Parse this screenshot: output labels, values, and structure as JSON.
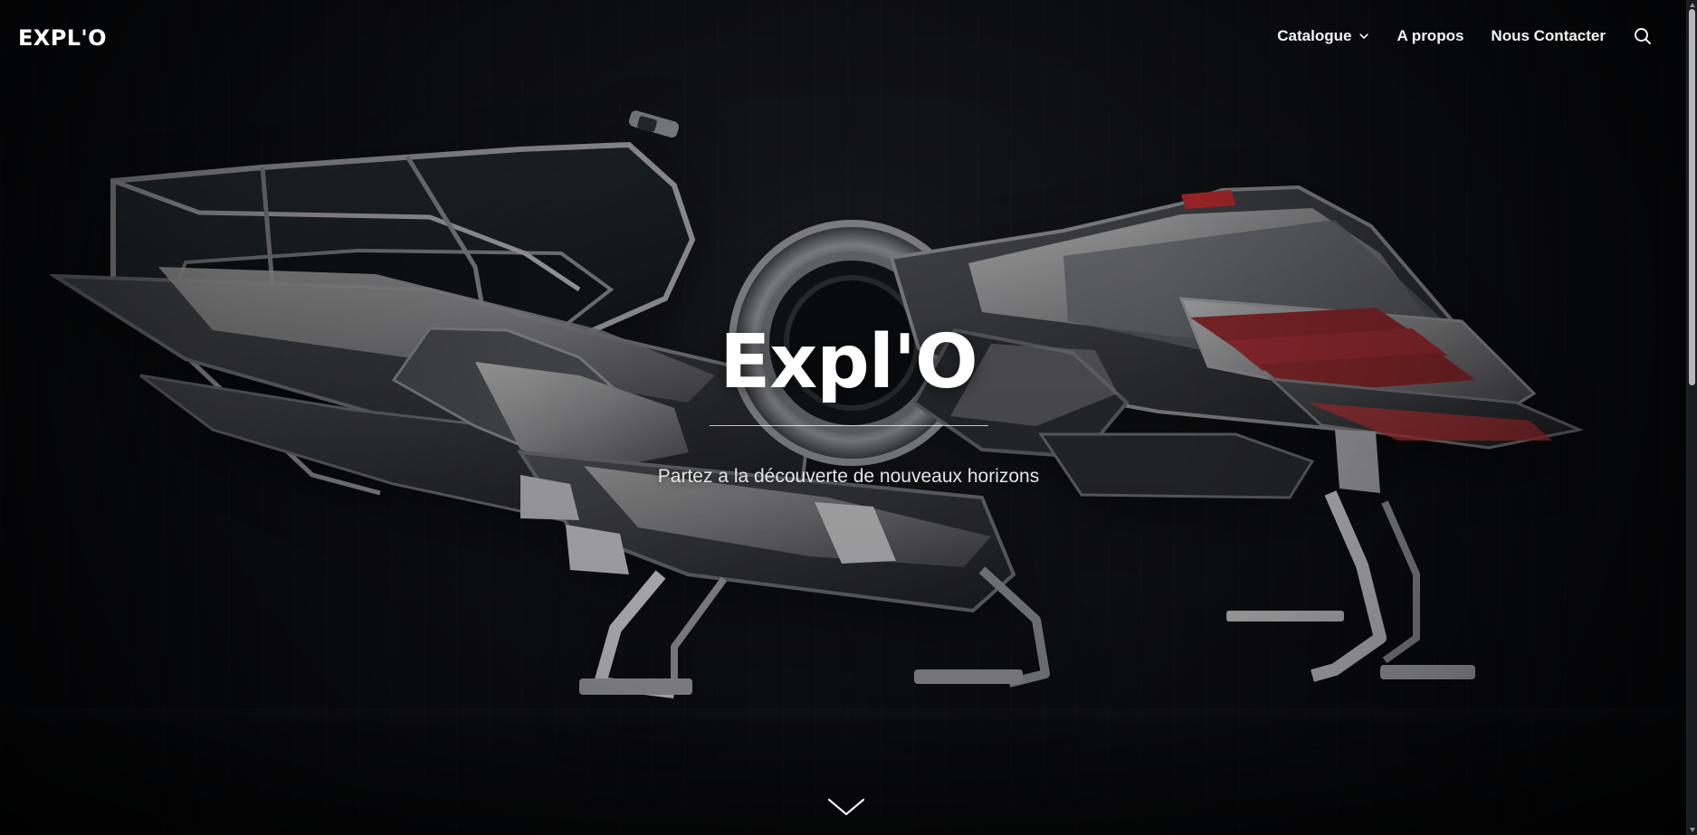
{
  "header": {
    "brand": "EXPL'O",
    "nav": {
      "catalogue": "Catalogue",
      "about": "A propos",
      "contact": "Nous Contacter"
    }
  },
  "hero": {
    "title": "Expl'O",
    "subtitle": "Partez a la découverte de nouveaux horizons"
  },
  "icons": {
    "catalogue_chevron": "chevron-down-icon",
    "search": "search-icon",
    "scroll_down": "scroll-down-icon"
  },
  "colors": {
    "text_primary": "#ffffff",
    "text_secondary": "#e4e4e4",
    "background_dark": "#0b0c0f",
    "accent_red": "#c53a3a"
  }
}
